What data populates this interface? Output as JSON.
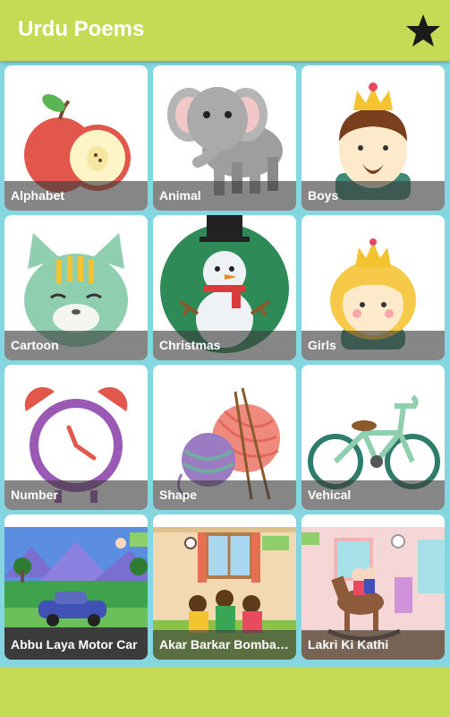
{
  "app": {
    "title": "Urdu Poems",
    "favorites_icon": "star-icon"
  },
  "colors": {
    "appbar": "#c5db55",
    "grid_background": "#84d7e0",
    "card": "#ffffff",
    "label_overlay": "#3c3c3c"
  },
  "categories": [
    {
      "label": "Alphabet",
      "icon": "apple-icon"
    },
    {
      "label": "Animal",
      "icon": "elephant-icon"
    },
    {
      "label": "Boys",
      "icon": "prince-icon"
    },
    {
      "label": "Cartoon",
      "icon": "cat-icon"
    },
    {
      "label": "Christmas",
      "icon": "snowman-icon"
    },
    {
      "label": "Girls",
      "icon": "princess-icon"
    },
    {
      "label": "Number",
      "icon": "alarm-clock-icon"
    },
    {
      "label": "Shape",
      "icon": "yarn-balls-icon"
    },
    {
      "label": "Vehical",
      "icon": "bicycle-icon"
    }
  ],
  "poems": [
    {
      "label": "Abbu Laya Motor Car"
    },
    {
      "label": "Akar Barkar Bombay Bo"
    },
    {
      "label": "Lakri Ki Kathi"
    }
  ]
}
